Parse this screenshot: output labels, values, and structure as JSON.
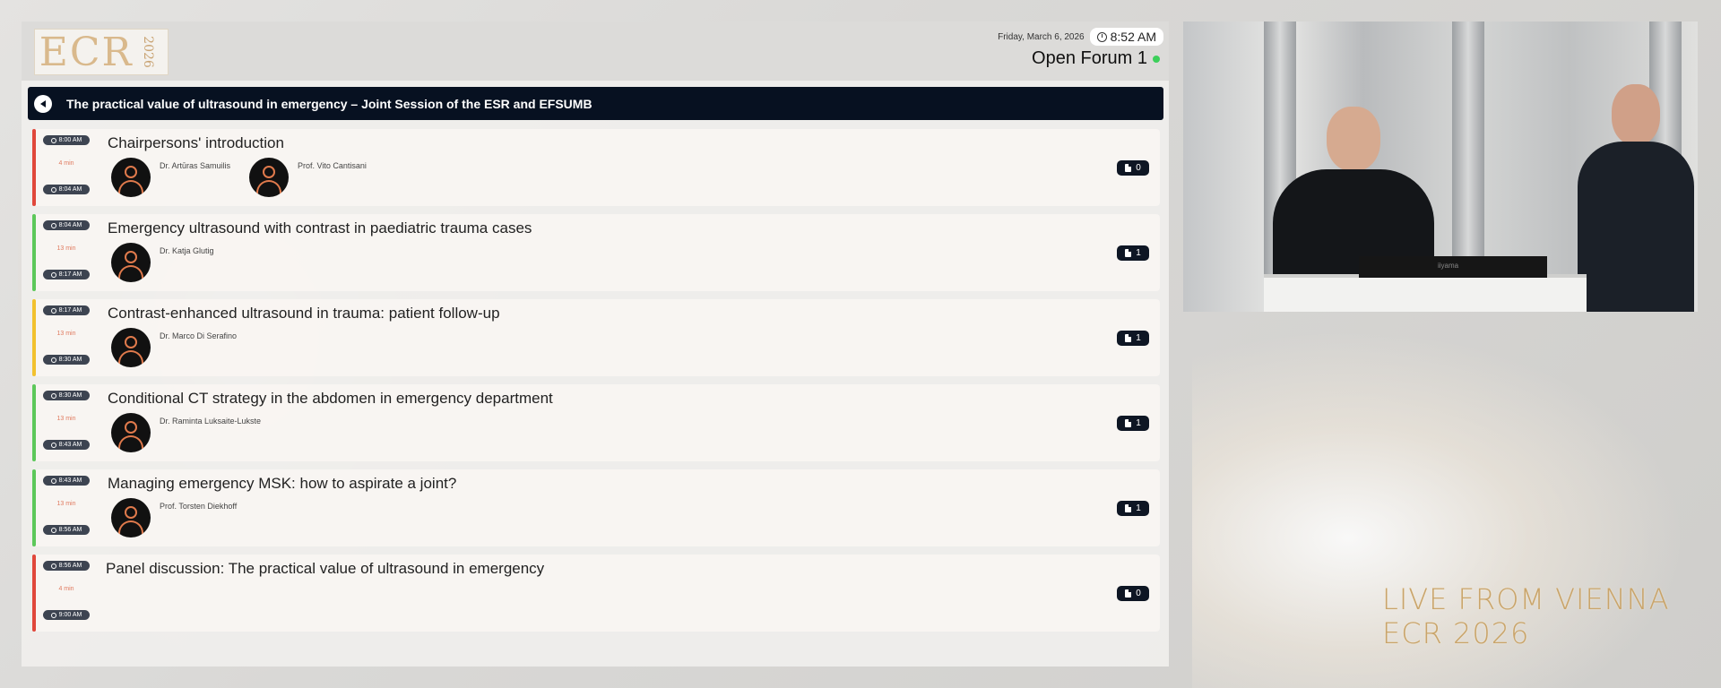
{
  "header": {
    "logo_text": "ECR",
    "logo_year": "2026",
    "date": "Friday, March 6, 2026",
    "time": "8:52 AM",
    "room": "Open Forum 1"
  },
  "session": {
    "title": "The practical value of ultrasound in emergency – Joint Session of the ESR and EFSUMB"
  },
  "items": [
    {
      "start": "8:00 AM",
      "duration": "4 min",
      "end": "8:04 AM",
      "title": "Chairpersons' introduction",
      "speakers": [
        "Dr. Artūras Samuilis",
        "Prof. Vito Cantisani"
      ],
      "docs": "0",
      "stripe": "#e0473b"
    },
    {
      "start": "8:04 AM",
      "duration": "13 min",
      "end": "8:17 AM",
      "title": "Emergency ultrasound with contrast in paediatric trauma cases",
      "speakers": [
        "Dr. Katja Glutig"
      ],
      "docs": "1",
      "stripe": "#5cc85a"
    },
    {
      "start": "8:17 AM",
      "duration": "13 min",
      "end": "8:30 AM",
      "title": "Contrast-enhanced ultrasound in trauma: patient follow-up",
      "speakers": [
        "Dr. Marco Di Serafino"
      ],
      "docs": "1",
      "stripe": "#f2c12e"
    },
    {
      "start": "8:30 AM",
      "duration": "13 min",
      "end": "8:43 AM",
      "title": "Conditional CT strategy in the abdomen in emergency department",
      "speakers": [
        "Dr. Raminta Luksaite-Lukste"
      ],
      "docs": "1",
      "stripe": "#5cc85a"
    },
    {
      "start": "8:43 AM",
      "duration": "13 min",
      "end": "8:56 AM",
      "title": "Managing emergency MSK: how to aspirate a joint?",
      "speakers": [
        "Prof. Torsten Diekhoff"
      ],
      "docs": "1",
      "stripe": "#5cc85a"
    },
    {
      "start": "8:56 AM",
      "duration": "4 min",
      "end": "9:00 AM",
      "title": "Panel discussion: The practical value of ultrasound in emergency",
      "speakers": [],
      "docs": "0",
      "stripe": "#e0473b"
    }
  ],
  "video": {
    "laptop_brand": "iiyama"
  },
  "branding": {
    "line1": "LIVE FROM VIENNA",
    "line2": "ECR 2026"
  }
}
